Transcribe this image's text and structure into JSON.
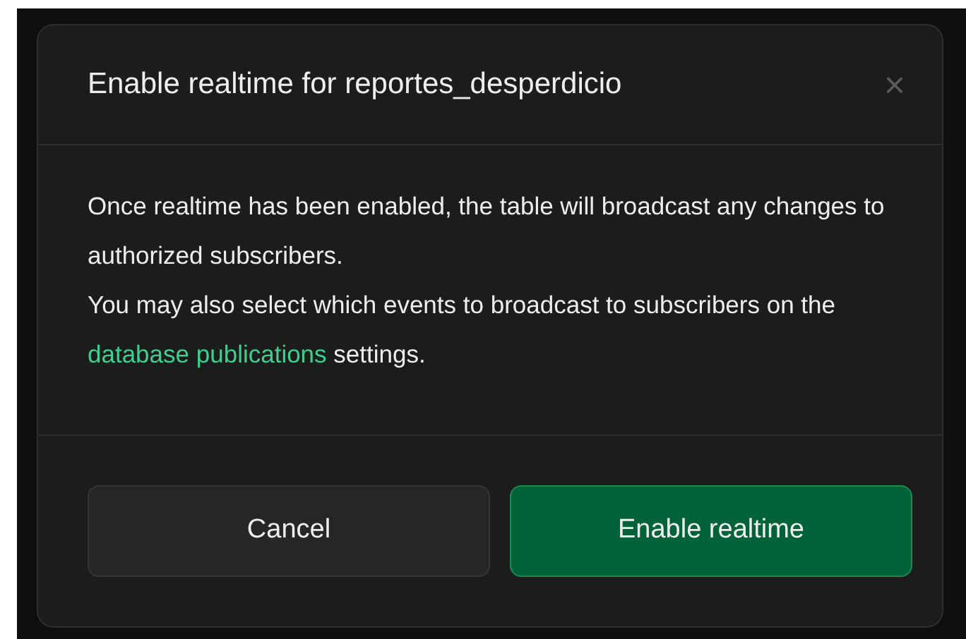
{
  "dialog": {
    "title": "Enable realtime for reportes_desperdicio",
    "close": "×",
    "paragraphs": [
      {
        "text": "Once realtime has been enabled, the table will broadcast any changes to authorized subscribers."
      },
      {
        "text": "You may also select which events to broadcast to subscribers on the ",
        "link": "database publications",
        "text_after": " settings."
      }
    ],
    "buttons": [
      {
        "label": "Cancel",
        "kind": "secondary"
      },
      {
        "label": "Enable realtime",
        "kind": "primary"
      }
    ]
  }
}
